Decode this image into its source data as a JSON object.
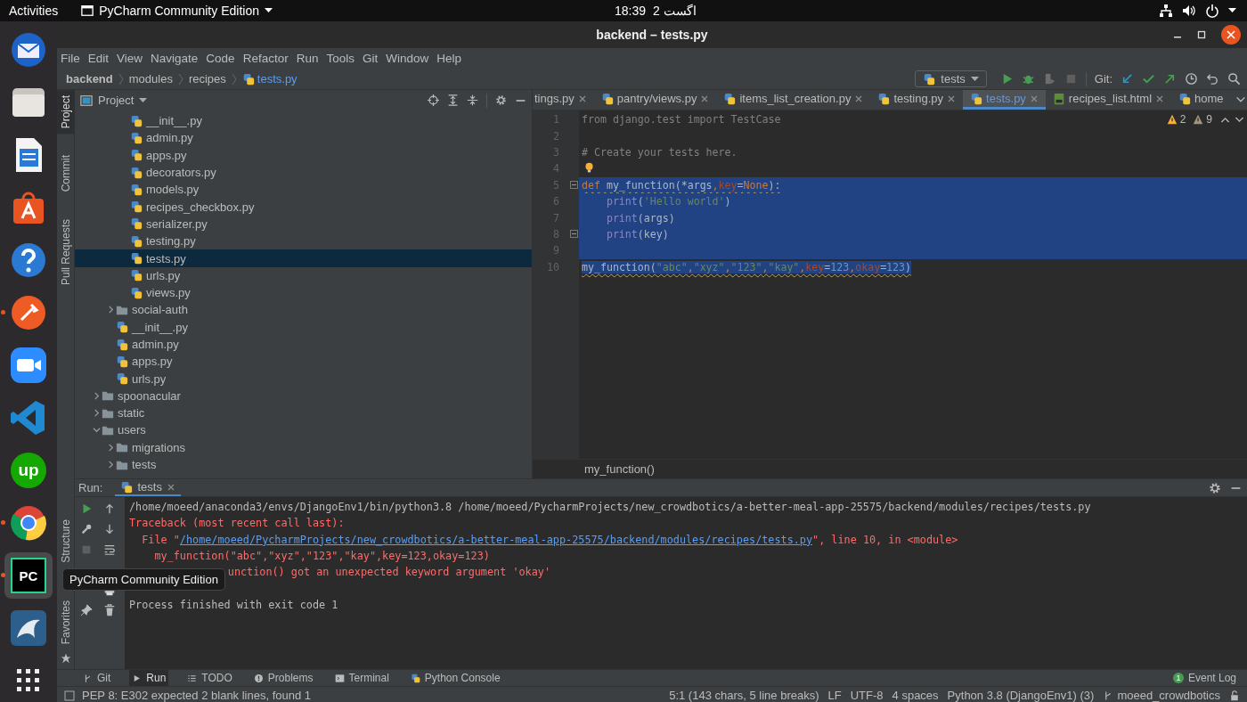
{
  "top_bar": {
    "activities": "Activities",
    "app_menu": "PyCharm Community Edition",
    "time": "18:39",
    "date": "2 اگست"
  },
  "dock": [
    {
      "kind": "mail",
      "selected": false,
      "running": false
    },
    {
      "kind": "files",
      "selected": false,
      "running": false
    },
    {
      "kind": "writer",
      "selected": false,
      "running": false
    },
    {
      "kind": "store",
      "selected": false,
      "running": false
    },
    {
      "kind": "help",
      "selected": false,
      "running": false
    },
    {
      "kind": "postman",
      "selected": false,
      "running": true
    },
    {
      "kind": "zoom",
      "selected": false,
      "running": false
    },
    {
      "kind": "vscode",
      "selected": false,
      "running": false
    },
    {
      "kind": "upwork",
      "glyph": "up",
      "selected": false,
      "running": false
    },
    {
      "kind": "chrome",
      "selected": false,
      "running": true
    },
    {
      "kind": "pycharm",
      "glyph": "PC",
      "selected": true,
      "running": true
    },
    {
      "kind": "dolphin",
      "selected": false,
      "running": false
    },
    {
      "kind": "apps",
      "selected": false,
      "running": false
    }
  ],
  "tooltip": "PyCharm Community Edition",
  "window": {
    "title": "backend – tests.py"
  },
  "menu": [
    "File",
    "Edit",
    "View",
    "Navigate",
    "Code",
    "Refactor",
    "Run",
    "Tools",
    "Git",
    "Window",
    "Help"
  ],
  "breadcrumb": [
    "backend",
    "modules",
    "recipes",
    "tests.py"
  ],
  "run_config": "tests",
  "git_label": "Git:",
  "left_stripe": [
    {
      "label": "Project",
      "selected": true
    },
    {
      "label": "Commit",
      "selected": false
    },
    {
      "label": "Pull Requests",
      "selected": false
    }
  ],
  "left_stripe_bottom": [
    {
      "label": "Structure",
      "kind": "structure"
    },
    {
      "label": "Favorites",
      "kind": "favorites"
    }
  ],
  "project": {
    "title": "Project",
    "tree": [
      {
        "children": [
          {
            "children": [
              {
                "label": "__init__.py",
                "kind": "python",
                "selected": false
              },
              {
                "label": "admin.py",
                "kind": "python",
                "selected": false
              },
              {
                "label": "apps.py",
                "kind": "python",
                "selected": false
              },
              {
                "label": "decorators.py",
                "kind": "python",
                "selected": false
              },
              {
                "label": "models.py",
                "kind": "python",
                "selected": false
              },
              {
                "label": "recipes_checkbox.py",
                "kind": "python",
                "selected": false
              },
              {
                "label": "serializer.py",
                "kind": "python",
                "selected": false
              },
              {
                "label": "testing.py",
                "kind": "python",
                "selected": false
              },
              {
                "label": "tests.py",
                "kind": "python",
                "selected": true
              },
              {
                "label": "urls.py",
                "kind": "python",
                "selected": false
              },
              {
                "label": "views.py",
                "kind": "python",
                "selected": false
              }
            ]
          },
          {
            "label": "social-auth",
            "kind": "folder",
            "expanded": false,
            "selected": false
          },
          {
            "label": "__init__.py",
            "kind": "python",
            "selected": false
          },
          {
            "label": "admin.py",
            "kind": "python",
            "selected": false
          },
          {
            "label": "apps.py",
            "kind": "python",
            "selected": false
          },
          {
            "label": "urls.py",
            "kind": "python",
            "selected": false
          }
        ]
      },
      {
        "label": "spoonacular",
        "kind": "folder",
        "expanded": false,
        "selected": false
      },
      {
        "label": "static",
        "kind": "folder",
        "expanded": false,
        "selected": false
      },
      {
        "label": "users",
        "kind": "folder",
        "expanded": true,
        "selected": false,
        "children": [
          {
            "label": "migrations",
            "kind": "folder",
            "expanded": false,
            "selected": false
          },
          {
            "label": "tests",
            "kind": "folder",
            "expanded": false,
            "selected": false
          }
        ]
      }
    ]
  },
  "editor": {
    "tabs": [
      {
        "label": "tings.py",
        "selected": false,
        "closable": true
      },
      {
        "label": "pantry/views.py",
        "kind": "python",
        "selected": false,
        "closable": true
      },
      {
        "label": "items_list_creation.py",
        "kind": "python",
        "selected": false,
        "closable": true
      },
      {
        "label": "testing.py",
        "kind": "python",
        "selected": false,
        "closable": true
      },
      {
        "label": "tests.py",
        "kind": "python",
        "selected": true,
        "closable": true
      },
      {
        "label": "recipes_list.html",
        "kind": "html",
        "selected": false,
        "closable": true
      },
      {
        "label": "home",
        "kind": "python",
        "selected": false,
        "closable": false
      }
    ],
    "warnings": "2",
    "weak_warnings": "9",
    "lines": [
      {
        "number": "1",
        "selected": false,
        "tokens": [
          {
            "text": "from django.test import TestCase",
            "kind": "muted"
          }
        ]
      },
      {
        "number": "2",
        "selected": false
      },
      {
        "number": "3",
        "selected": false,
        "tokens": [
          {
            "text": "# Create your tests here.",
            "kind": "comment"
          }
        ]
      },
      {
        "number": "4",
        "selected": false,
        "intention": true
      },
      {
        "number": "5",
        "selected": true,
        "warning": true,
        "fold": true,
        "tokens": [
          {
            "text": "def",
            "kind": "kw"
          },
          {
            "text": " my_function(*args",
            "kind": "plain"
          },
          {
            "text": ",",
            "kind": "kw"
          },
          {
            "text": "key",
            "kind": "param"
          },
          {
            "text": "=",
            "kind": "plain"
          },
          {
            "text": "None",
            "kind": "kw"
          },
          {
            "text": "):",
            "kind": "plain"
          }
        ]
      },
      {
        "number": "6",
        "selected": true,
        "indented": true,
        "tokens": [
          {
            "text": "print",
            "kind": "builtin"
          },
          {
            "text": "(",
            "kind": "plain"
          },
          {
            "text": "'Hello world'",
            "kind": "str"
          },
          {
            "text": ")",
            "kind": "plain"
          }
        ]
      },
      {
        "number": "7",
        "selected": true,
        "indented": true,
        "tokens": [
          {
            "text": "print",
            "kind": "builtin"
          },
          {
            "text": "(args)",
            "kind": "plain"
          }
        ]
      },
      {
        "number": "8",
        "selected": true,
        "indented": true,
        "fold": true,
        "tokens": [
          {
            "text": "print",
            "kind": "builtin"
          },
          {
            "text": "(key)",
            "kind": "plain"
          }
        ]
      },
      {
        "number": "9",
        "selected": true
      },
      {
        "number": "10",
        "selected": true,
        "warning": true,
        "tokens": [
          {
            "text": "my_function(",
            "kind": "plain"
          },
          {
            "text": "\"abc\"",
            "kind": "str"
          },
          {
            "text": ",",
            "kind": "kw"
          },
          {
            "text": "\"xyz\"",
            "kind": "str"
          },
          {
            "text": ",",
            "kind": "kw"
          },
          {
            "text": "\"123\"",
            "kind": "str"
          },
          {
            "text": ",",
            "kind": "kw"
          },
          {
            "text": "\"kay\"",
            "kind": "str"
          },
          {
            "text": ",",
            "kind": "kw"
          },
          {
            "text": "key",
            "kind": "param"
          },
          {
            "text": "=",
            "kind": "plain"
          },
          {
            "text": "123",
            "kind": "num"
          },
          {
            "text": ",",
            "kind": "kw"
          },
          {
            "text": "okay",
            "kind": "param"
          },
          {
            "text": "=",
            "kind": "plain"
          },
          {
            "text": "123",
            "kind": "num"
          },
          {
            "text": ")",
            "kind": "plain"
          }
        ]
      }
    ],
    "breadcrumb": "my_function()"
  },
  "run": {
    "label": "Run:",
    "tab": "tests",
    "console": [
      {
        "segments": [
          {
            "text": "/home/moeed/anaconda3/envs/DjangoEnv1/bin/python3.8 /home/moeed/PycharmProjects/new_crowdbotics/a-better-meal-app-25575/backend/modules/recipes/tests.py",
            "kind": "plain"
          }
        ]
      },
      {
        "segments": [
          {
            "text": "Traceback (most recent call last):",
            "kind": "error"
          }
        ]
      },
      {
        "segments": [
          {
            "text": "  File \"",
            "kind": "error"
          },
          {
            "text": "/home/moeed/PycharmProjects/new_crowdbotics/a-better-meal-app-25575/backend/modules/recipes/tests.py",
            "kind": "link"
          },
          {
            "text": "\", line 10, in <module>",
            "kind": "error"
          }
        ]
      },
      {
        "segments": [
          {
            "text": "    my_function(\"abc\",\"xyz\",\"123\",\"kay\",key=123,okay=123)",
            "kind": "error"
          }
        ]
      },
      {
        "partly_covered": true,
        "segments": [
          {
            "text": "unction() got an unexpected keyword argument 'okay'",
            "kind": "error"
          }
        ]
      },
      {
        "gap_before": true,
        "segments": [
          {
            "text": "Process finished with exit code 1",
            "kind": "plain"
          }
        ]
      }
    ]
  },
  "tool_windows": [
    {
      "label": "Git",
      "kind": "git",
      "selected": false
    },
    {
      "label": "Run",
      "kind": "run",
      "selected": true
    },
    {
      "label": "TODO",
      "kind": "todo",
      "selected": false
    },
    {
      "label": "Problems",
      "kind": "problems",
      "selected": false
    },
    {
      "label": "Terminal",
      "kind": "terminal",
      "selected": false
    },
    {
      "label": "Python Console",
      "kind": "python",
      "selected": false
    }
  ],
  "event_log": {
    "label": "Event Log",
    "count": "1"
  },
  "status": {
    "message": "PEP 8: E302 expected 2 blank lines, found 1",
    "items": [
      "5:1 (143 chars, 5 line breaks)",
      "LF",
      "UTF-8",
      "4 spaces",
      "Python 3.8 (DjangoEnv1) (3)"
    ],
    "branch": "moeed_crowdbotics"
  }
}
